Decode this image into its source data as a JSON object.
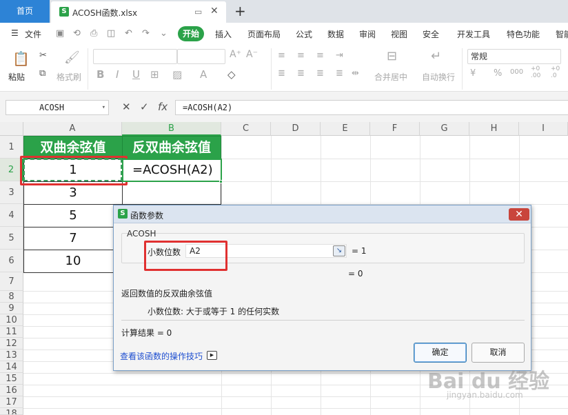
{
  "tabs": {
    "home": "首页",
    "file": "ACOSH函数.xlsx",
    "file_badge": "S",
    "monitor_icon": "monitor-icon",
    "close": "✕",
    "plus": "+"
  },
  "menu": {
    "file": "文件",
    "active": "开始",
    "items": [
      "插入",
      "页面布局",
      "公式",
      "数据",
      "审阅",
      "视图",
      "安全",
      "开发工具",
      "特色功能",
      "智能"
    ]
  },
  "ribbon": {
    "paste": "粘贴",
    "format_painter": "格式刷",
    "merge_center": "合并居中",
    "wrap_text": "自动换行",
    "number_format": "常规",
    "glyphs": {
      "bold": "B",
      "italic": "I",
      "underline": "U",
      "font_grow": "A⁺",
      "font_shrink": "A⁻",
      "font_color": "A",
      "currency": "¥",
      "percent": "%",
      "thousands": "000",
      "dec_increase": "+0 .00",
      "dec_decrease": "+0 .0"
    }
  },
  "formula_bar": {
    "name_box": "ACOSH",
    "fx": "fx",
    "cancel": "✕",
    "confirm": "✓",
    "formula": "=ACOSH(A2)"
  },
  "sheet": {
    "columns": [
      "A",
      "B",
      "C",
      "D",
      "E",
      "F",
      "G",
      "H",
      "I"
    ],
    "rows": [
      "1",
      "2",
      "3",
      "4",
      "5",
      "6",
      "7",
      "8",
      "9",
      "10",
      "11",
      "12",
      "13",
      "14",
      "15",
      "16",
      "17",
      "18"
    ],
    "header_a": "双曲余弦值",
    "header_b": "反双曲余弦值",
    "values_a": [
      "1",
      "3",
      "5",
      "7",
      "10"
    ],
    "b2_formula": "=ACOSH(A2)"
  },
  "dialog": {
    "title": "函数参数",
    "function_name": "ACOSH",
    "arg_label": "小数位数",
    "arg_value": "A2",
    "arg_result": "= 1",
    "function_result": "= 0",
    "description": "返回数值的反双曲余弦值",
    "arg_description": "小数位数:  大于或等于 1 的任何实数",
    "calc_result": "计算结果  =  0",
    "tip_link": "查看该函数的操作技巧",
    "ok": "确定",
    "cancel": "取消",
    "close": "✕"
  },
  "watermark": {
    "brand": "Bai du 经验",
    "url": "jingyan.baidu.com"
  },
  "colors": {
    "accent": "#2ba249",
    "home_tab": "#2d83d6",
    "highlight": "#e03030"
  }
}
